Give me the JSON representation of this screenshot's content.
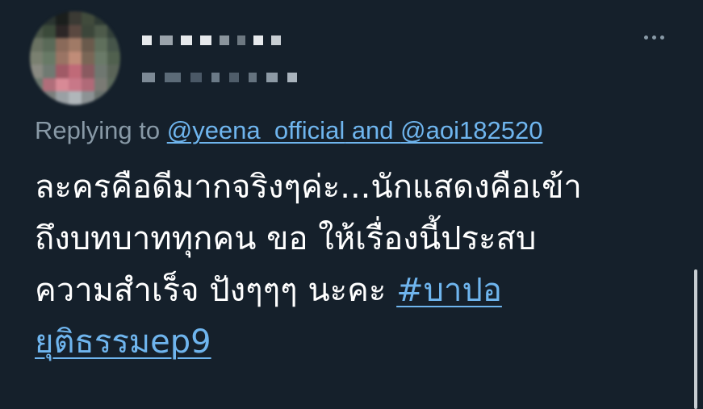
{
  "header": {
    "more_icon": "more-horizontal-icon"
  },
  "reply": {
    "prefix": "Replying to ",
    "mention_1": "@yeena_official",
    "joiner": " and ",
    "mention_2": "@aoi182520"
  },
  "tweet": {
    "line_1": "ละครคือดีมากจริงๆค่ะ...นักแสดงคือเข้า",
    "line_2": "ถึงบทบาททุกคน ขอ ให้เรื่องนี้ประสบ",
    "line_3_text": "ความสำเร็จ ปังๆๆๆ นะคะ ",
    "hashtag_part_1": "#บาปอ",
    "hashtag_part_2": "ยุติธรรมep9"
  },
  "colors": {
    "background": "#15202b",
    "text": "#ffffff",
    "secondary": "#8899a6",
    "link": "#6fb5ee"
  }
}
